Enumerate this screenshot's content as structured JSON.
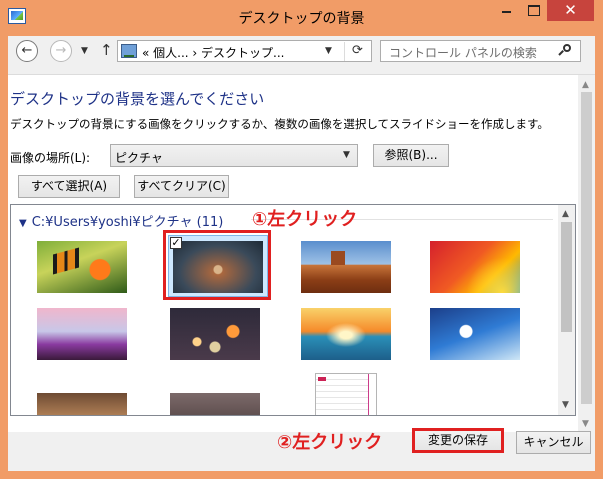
{
  "window": {
    "title": "デスクトップの背景",
    "close_glyph": "✕"
  },
  "navbar": {
    "back_glyph": "←",
    "forward_glyph": "→",
    "dropdown_glyph": "▼",
    "up_glyph": "↑",
    "address_text": "« 個人... › デスクトップ...",
    "address_dropdown_glyph": "▼",
    "refresh_glyph": "⟳",
    "search_placeholder": "コントロール パネルの検索"
  },
  "page": {
    "heading": "デスクトップの背景を選んでください",
    "description": "デスクトップの背景にする画像をクリックするか、複数の画像を選択してスライドショーを作成します。",
    "location_label": "画像の場所(L):",
    "location_value": "ピクチャ",
    "location_arrow": "▼",
    "browse_label": "参照(B)...",
    "select_all_label": "すべて選択(A)",
    "clear_all_label": "すべてクリア(C)"
  },
  "gallery": {
    "folder_chevron": "▼",
    "folder_title": "C:¥Users¥yoshi¥ピクチャ (11)",
    "checkmark": "✓",
    "scroll_up_glyph": "▲",
    "scroll_down_glyph": "▼",
    "thumbnails": [
      {
        "icon": "butterfly-flower-thumbnail",
        "selected": false
      },
      {
        "icon": "city-night-aerial-thumbnail",
        "selected": true
      },
      {
        "icon": "desert-monument-valley-thumbnail",
        "selected": false
      },
      {
        "icon": "colorful-abstract-thumbnail",
        "selected": false
      },
      {
        "icon": "tulip-field-thumbnail",
        "selected": false
      },
      {
        "icon": "bokeh-lights-thumbnail",
        "selected": false
      },
      {
        "icon": "ocean-sunset-thumbnail",
        "selected": false
      },
      {
        "icon": "surfer-wave-thumbnail",
        "selected": false
      },
      {
        "icon": "cheetah-thumbnail",
        "selected": false
      },
      {
        "icon": "dark-photo-thumbnail",
        "selected": false
      },
      {
        "icon": "screenshot-menu-thumbnail",
        "selected": false
      }
    ]
  },
  "annotations": {
    "step1": "①左クリック",
    "step2": "②左クリック",
    "color": "#e02020"
  },
  "footer": {
    "save_label": "変更の保存",
    "cancel_label": "キャンセル"
  },
  "scrollbar": {
    "up_glyph": "▲",
    "down_glyph": "▼"
  },
  "colors": {
    "titlebar": "#f19c67",
    "close_button": "#c7443d",
    "heading": "#1e3287",
    "selection": "#cde8ff"
  }
}
